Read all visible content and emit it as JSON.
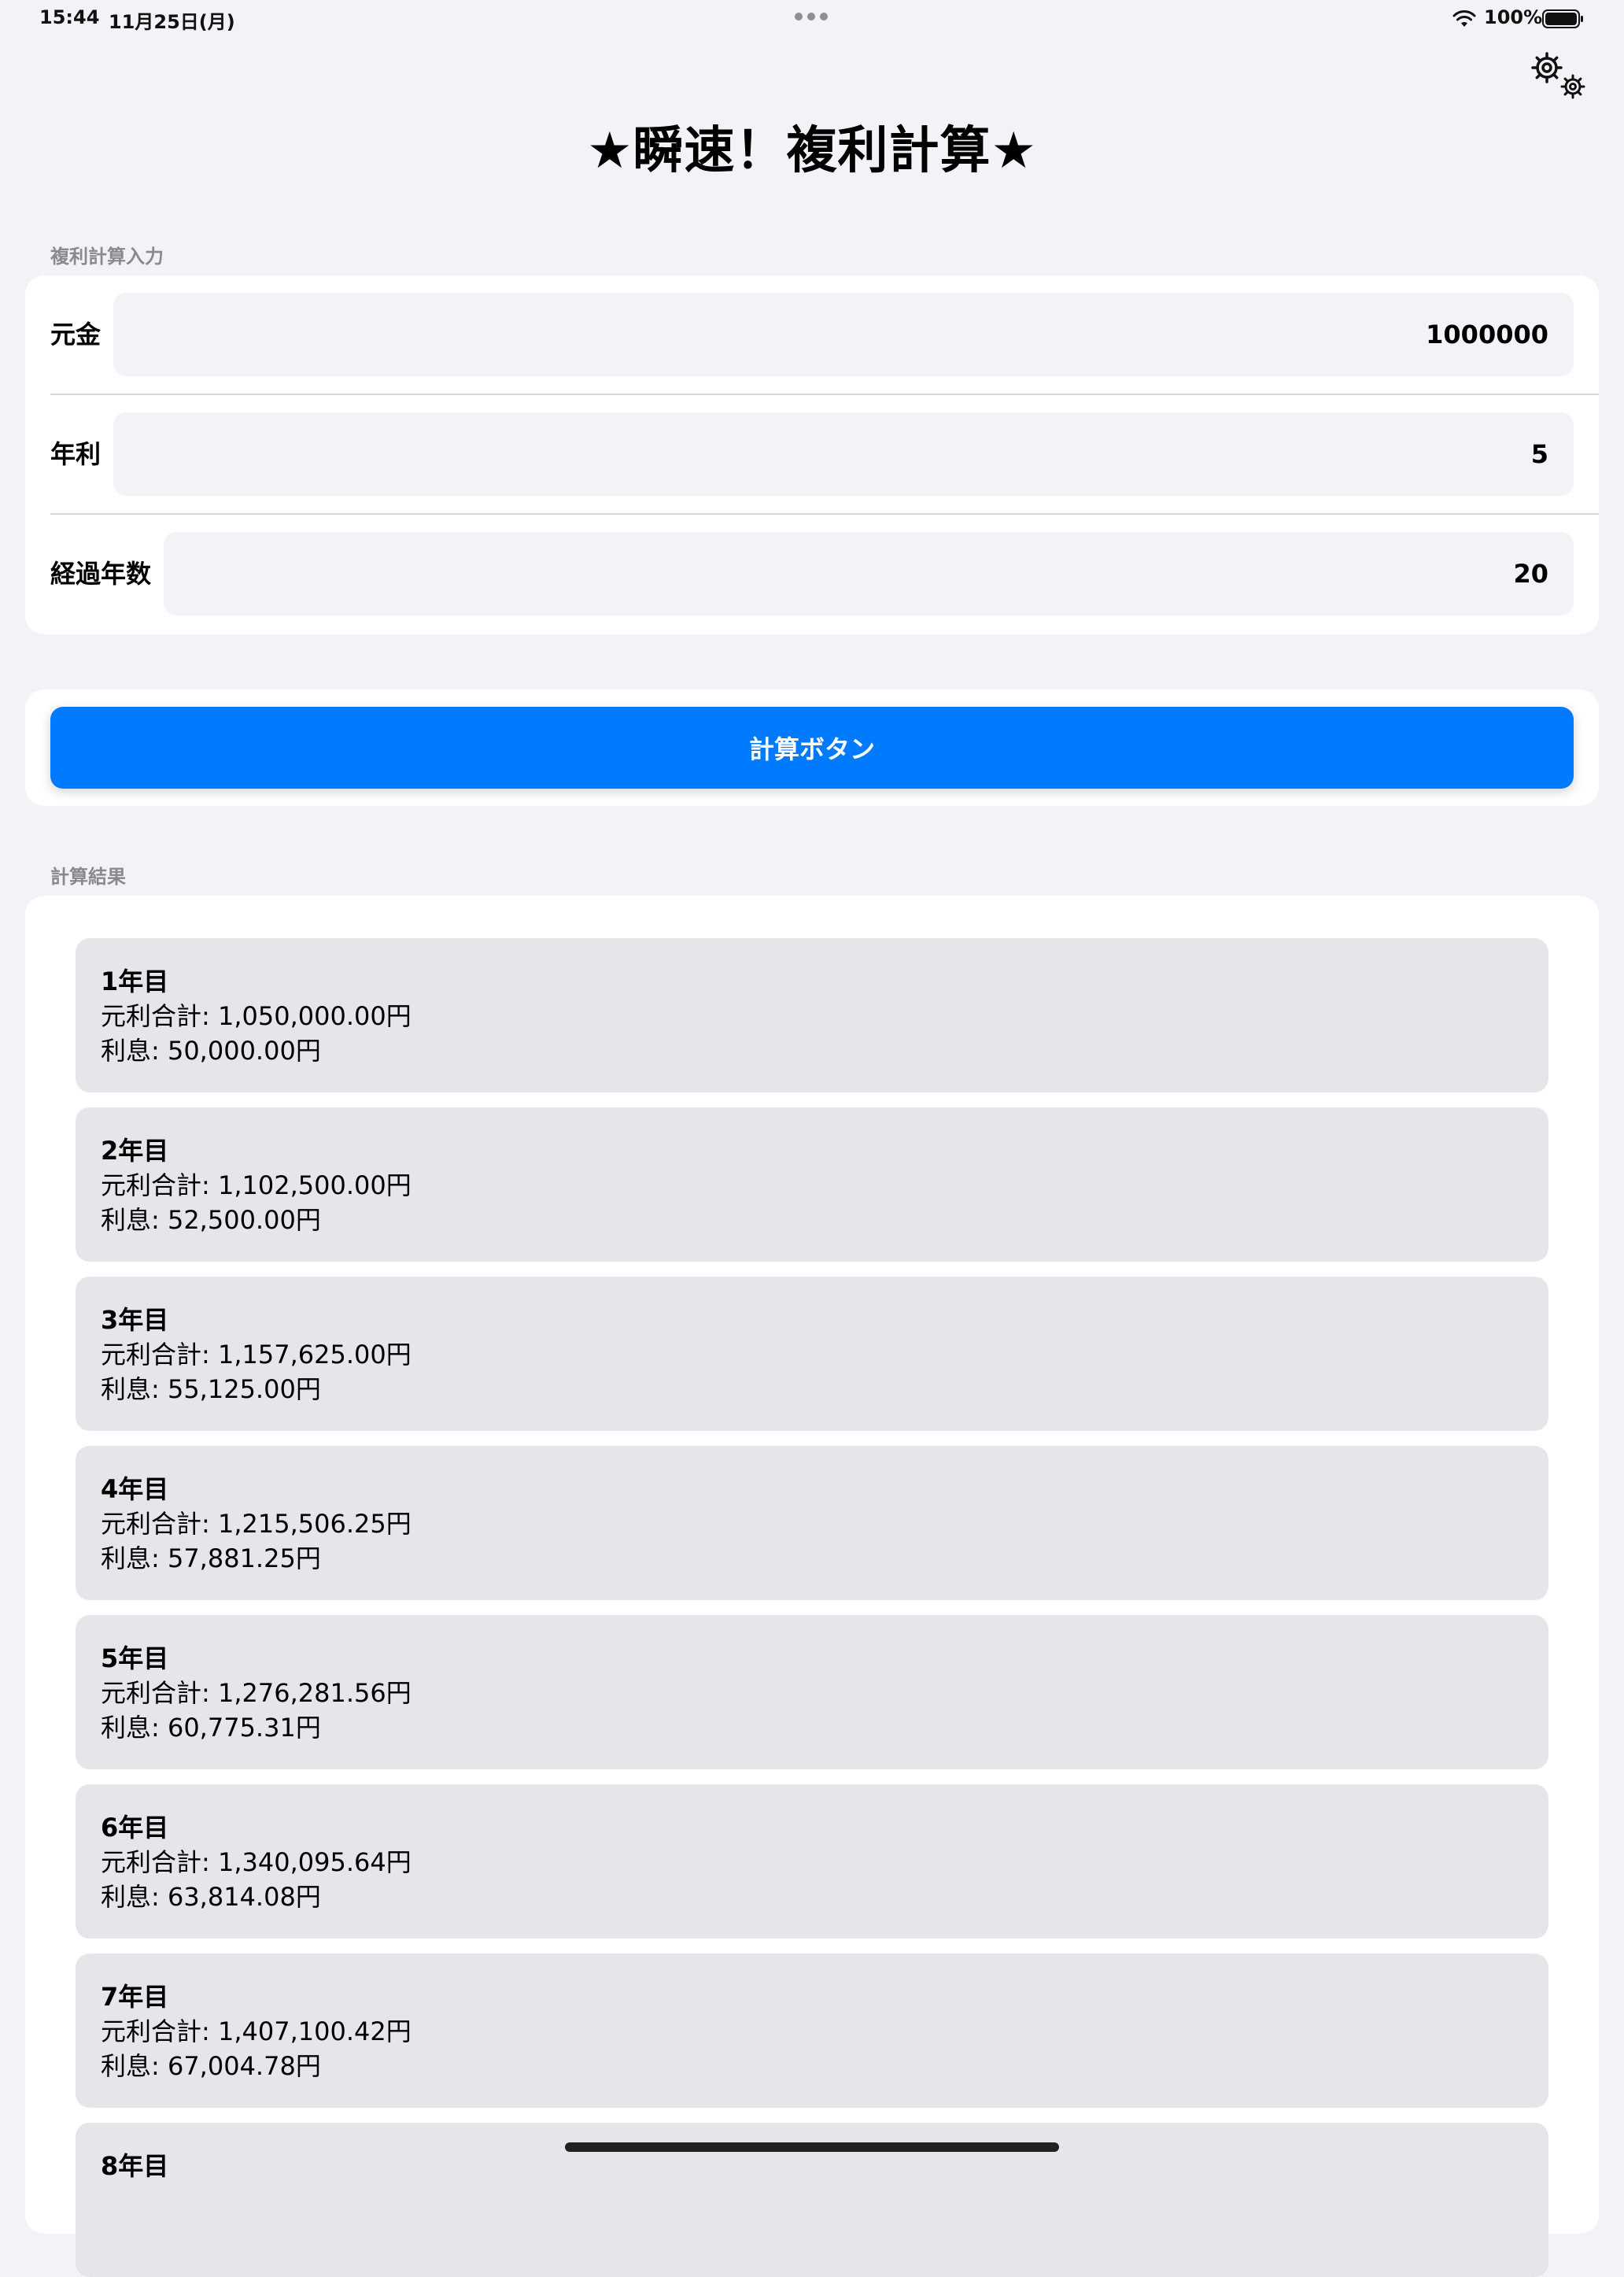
{
  "status_bar": {
    "time": "15:44",
    "date": "11月25日(月)",
    "battery": "100%",
    "icons": [
      "wifi-icon",
      "battery-icon"
    ]
  },
  "header": {
    "title": "★瞬速！複利計算★",
    "settings_icon": "gear-icon"
  },
  "input_section": {
    "header": "複利計算入力",
    "fields": [
      {
        "label": "元金",
        "value": "1000000"
      },
      {
        "label": "年利",
        "value": "5"
      },
      {
        "label": "経過年数",
        "value": "20"
      }
    ]
  },
  "calculate_button": {
    "label": "計算ボタン"
  },
  "results_section": {
    "header": "計算結果",
    "items": [
      {
        "year": "1年目",
        "total": "元利合計: 1,050,000.00円",
        "interest": "利息: 50,000.00円"
      },
      {
        "year": "2年目",
        "total": "元利合計: 1,102,500.00円",
        "interest": "利息: 52,500.00円"
      },
      {
        "year": "3年目",
        "total": "元利合計: 1,157,625.00円",
        "interest": "利息: 55,125.00円"
      },
      {
        "year": "4年目",
        "total": "元利合計: 1,215,506.25円",
        "interest": "利息: 57,881.25円"
      },
      {
        "year": "5年目",
        "total": "元利合計: 1,276,281.56円",
        "interest": "利息: 60,775.31円"
      },
      {
        "year": "6年目",
        "total": "元利合計: 1,340,095.64円",
        "interest": "利息: 63,814.08円"
      },
      {
        "year": "7年目",
        "total": "元利合計: 1,407,100.42円",
        "interest": "利息: 67,004.78円"
      },
      {
        "year": "8年目",
        "total": "",
        "interest": ""
      }
    ]
  },
  "colors": {
    "background": "#f2f2f7",
    "card": "#ffffff",
    "accent": "#007aff",
    "result_item": "#e5e5ea",
    "secondary_text": "#8a8a8e"
  }
}
